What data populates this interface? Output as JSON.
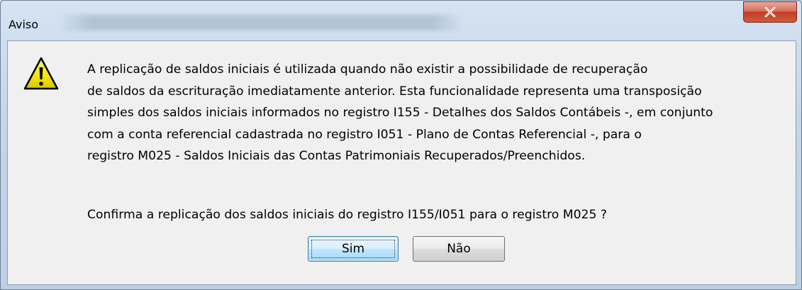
{
  "window": {
    "title": "Aviso",
    "close_glyph": "X"
  },
  "icon": {
    "name": "warning-icon",
    "fill_color": "#f5e400",
    "outline_color": "#000000"
  },
  "message": {
    "lines": [
      "A replicação de saldos iniciais é utilizada quando não existir a possibilidade de recuperação",
      "de saldos da escrituração imediatamente anterior. Esta funcionalidade representa uma transposição",
      "simples dos saldos iniciais informados no registro I155 - Detalhes dos Saldos Contábeis -, em conjunto",
      "com a conta referencial cadastrada no registro I051 - Plano de Contas Referencial -, para o",
      "registro M025 - Saldos Iniciais das Contas Patrimoniais Recuperados/Preenchidos."
    ],
    "question": "Confirma a replicação dos saldos iniciais do registro I155/I051 para o registro M025 ?"
  },
  "buttons": {
    "yes_label": "Sim",
    "no_label": "Não"
  },
  "colors": {
    "close_button": "#c74a2e",
    "default_button_border": "#3c7fb1"
  }
}
